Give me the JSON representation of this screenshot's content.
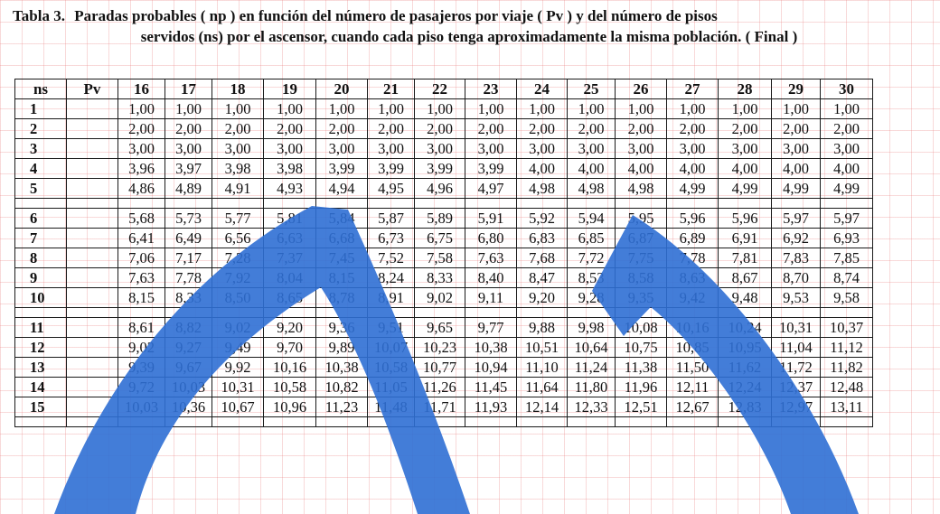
{
  "caption": {
    "label": "Tabla 3.",
    "line1": "Paradas probables ( np ) en función del número de pasajeros por viaje ( Pv ) y del número de pisos",
    "line2": "servidos (ns) por el ascensor, cuando cada piso tenga aproximadamente la misma población.",
    "continuation": "( Final )"
  },
  "table": {
    "corner_headers": [
      "ns",
      "Pv"
    ],
    "columns": [
      "16",
      "17",
      "18",
      "19",
      "20",
      "21",
      "22",
      "23",
      "24",
      "25",
      "26",
      "27",
      "28",
      "29",
      "30"
    ],
    "rows": [
      {
        "ns": "1",
        "values": [
          "1,00",
          "1,00",
          "1,00",
          "1,00",
          "1,00",
          "1,00",
          "1,00",
          "1,00",
          "1,00",
          "1,00",
          "1,00",
          "1,00",
          "1,00",
          "1,00",
          "1,00"
        ]
      },
      {
        "ns": "2",
        "values": [
          "2,00",
          "2,00",
          "2,00",
          "2,00",
          "2,00",
          "2,00",
          "2,00",
          "2,00",
          "2,00",
          "2,00",
          "2,00",
          "2,00",
          "2,00",
          "2,00",
          "2,00"
        ]
      },
      {
        "ns": "3",
        "values": [
          "3,00",
          "3,00",
          "3,00",
          "3,00",
          "3,00",
          "3,00",
          "3,00",
          "3,00",
          "3,00",
          "3,00",
          "3,00",
          "3,00",
          "3,00",
          "3,00",
          "3,00"
        ]
      },
      {
        "ns": "4",
        "values": [
          "3,96",
          "3,97",
          "3,98",
          "3,98",
          "3,99",
          "3,99",
          "3,99",
          "3,99",
          "4,00",
          "4,00",
          "4,00",
          "4,00",
          "4,00",
          "4,00",
          "4,00"
        ]
      },
      {
        "ns": "5",
        "values": [
          "4,86",
          "4,89",
          "4,91",
          "4,93",
          "4,94",
          "4,95",
          "4,96",
          "4,97",
          "4,98",
          "4,98",
          "4,98",
          "4,99",
          "4,99",
          "4,99",
          "4,99"
        ]
      },
      {
        "ns": "",
        "values": [
          "",
          "",
          "",
          "",
          "",
          "",
          "",
          "",
          "",
          "",
          "",
          "",
          "",
          "",
          ""
        ]
      },
      {
        "ns": "6",
        "values": [
          "5,68",
          "5,73",
          "5,77",
          "5,81",
          "5,84",
          "5,87",
          "5,89",
          "5,91",
          "5,92",
          "5,94",
          "5,95",
          "5,96",
          "5,96",
          "5,97",
          "5,97"
        ]
      },
      {
        "ns": "7",
        "values": [
          "6,41",
          "6,49",
          "6,56",
          "6,63",
          "6,68",
          "6,73",
          "6,75",
          "6,80",
          "6,83",
          "6,85",
          "6,87",
          "6,89",
          "6,91",
          "6,92",
          "6,93"
        ]
      },
      {
        "ns": "8",
        "values": [
          "7,06",
          "7,17",
          "7,28",
          "7,37",
          "7,45",
          "7,52",
          "7,58",
          "7,63",
          "7,68",
          "7,72",
          "7,75",
          "7,78",
          "7,81",
          "7,83",
          "7,85"
        ]
      },
      {
        "ns": "9",
        "values": [
          "7,63",
          "7,78",
          "7,92",
          "8,04",
          "8,15",
          "8,24",
          "8,33",
          "8,40",
          "8,47",
          "8,53",
          "8,58",
          "8,63",
          "8,67",
          "8,70",
          "8,74"
        ]
      },
      {
        "ns": "10",
        "values": [
          "8,15",
          "8,33",
          "8,50",
          "8,65",
          "8,78",
          "8,91",
          "9,02",
          "9,11",
          "9,20",
          "9,28",
          "9,35",
          "9,42",
          "9,48",
          "9,53",
          "9,58"
        ]
      },
      {
        "ns": "",
        "values": [
          "",
          "",
          "",
          "",
          "",
          "",
          "",
          "",
          "",
          "",
          "",
          "",
          "",
          "",
          ""
        ]
      },
      {
        "ns": "11",
        "values": [
          "8,61",
          "8,82",
          "9,02",
          "9,20",
          "9,36",
          "9,51",
          "9,65",
          "9,77",
          "9,88",
          "9,98",
          "10,08",
          "10,16",
          "10,24",
          "10,31",
          "10,37"
        ]
      },
      {
        "ns": "12",
        "values": [
          "9,02",
          "9,27",
          "9,49",
          "9,70",
          "9,89",
          "10,07",
          "10,23",
          "10,38",
          "10,51",
          "10,64",
          "10,75",
          "10,85",
          "10,95",
          "11,04",
          "11,12"
        ]
      },
      {
        "ns": "13",
        "values": [
          "9,39",
          "9,67",
          "9,92",
          "10,16",
          "10,38",
          "10,58",
          "10,77",
          "10,94",
          "11,10",
          "11,24",
          "11,38",
          "11,50",
          "11,62",
          "11,72",
          "11,82"
        ]
      },
      {
        "ns": "14",
        "values": [
          "9,72",
          "10,03",
          "10,31",
          "10,58",
          "10,82",
          "11,05",
          "11,26",
          "11,45",
          "11,64",
          "11,80",
          "11,96",
          "12,11",
          "12,24",
          "12,37",
          "12,48"
        ]
      },
      {
        "ns": "15",
        "values": [
          "10,03",
          "10,36",
          "10,67",
          "10,96",
          "11,23",
          "11,48",
          "11,71",
          "11,93",
          "12,14",
          "12,33",
          "12,51",
          "12,67",
          "12,83",
          "12,97",
          "13,11"
        ]
      },
      {
        "ns": "",
        "values": [
          "",
          "",
          "",
          "",
          "",
          "",
          "",
          "",
          "",
          "",
          "",
          "",
          "",
          "",
          ""
        ]
      }
    ]
  },
  "colors": {
    "overlay_blue": "#2f6fd4",
    "grid_red": "#e87878",
    "ink": "#111111"
  }
}
